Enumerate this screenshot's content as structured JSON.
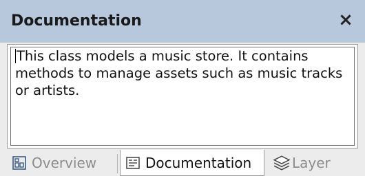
{
  "window": {
    "title": "Documentation",
    "close_label": "×"
  },
  "editor": {
    "text": "This class models a music store. It contains methods to manage assets such as music tracks or artists."
  },
  "tabs": [
    {
      "label": "Overview",
      "icon": "overview-icon",
      "active": false
    },
    {
      "label": "Documentation",
      "icon": "documentation-icon",
      "active": true
    },
    {
      "label": "Layer",
      "icon": "layer-icon",
      "active": false
    }
  ],
  "colors": {
    "titlebar": "#b7c8dd",
    "panel": "#ececec",
    "inactive_tab_text": "#8c8c8c"
  }
}
